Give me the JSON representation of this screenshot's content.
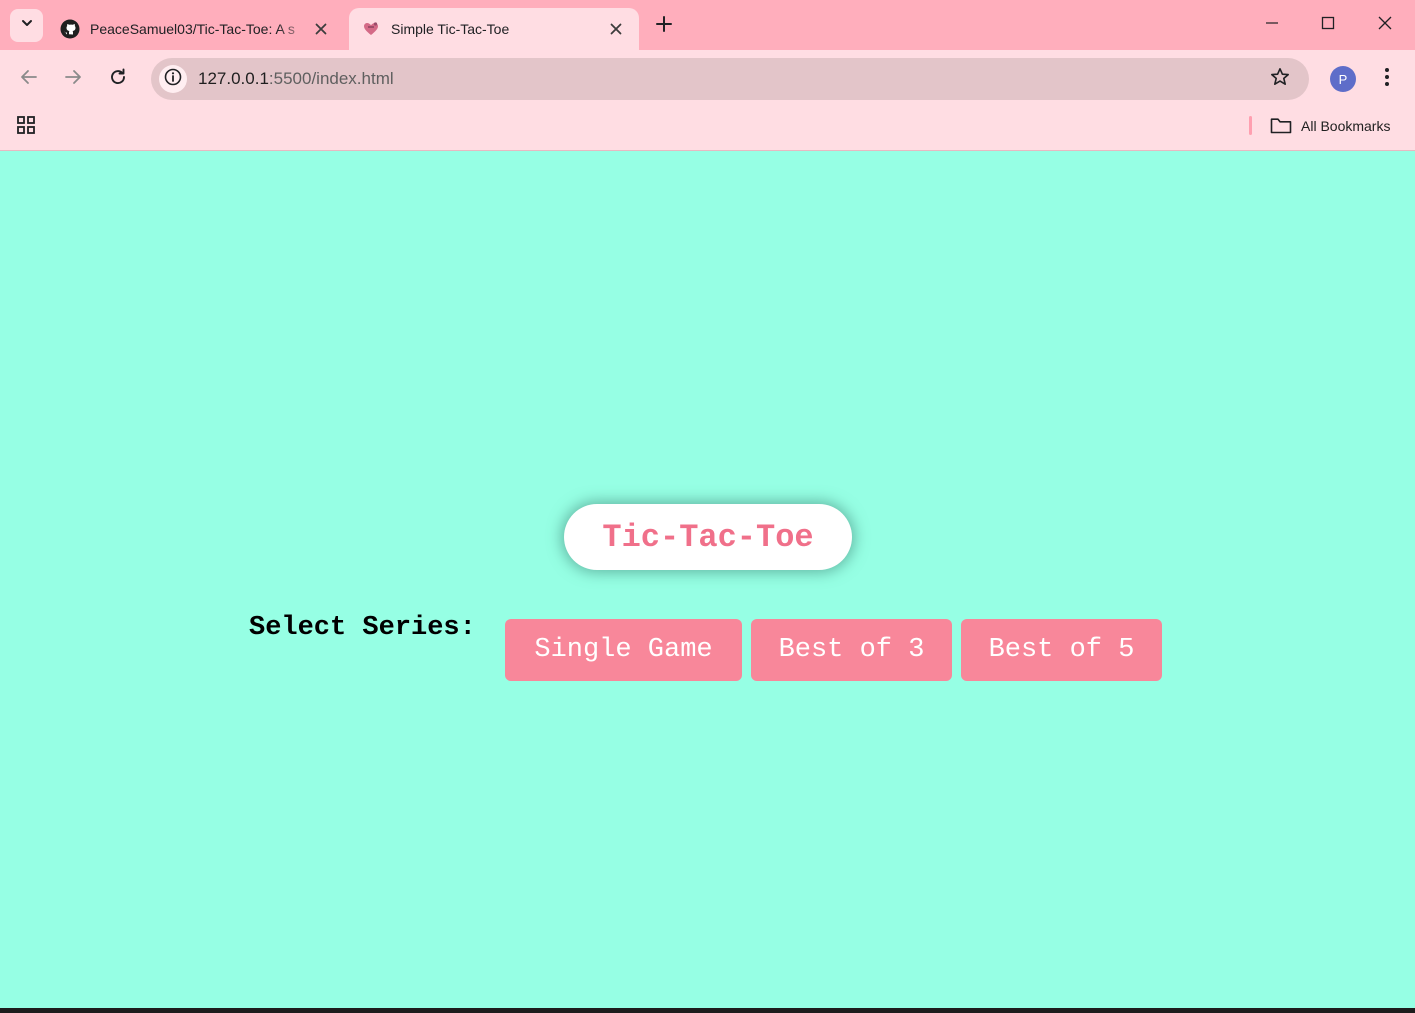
{
  "browser": {
    "tabs": [
      {
        "title": "PeaceSamuel03/Tic-Tac-Toe: A s",
        "favicon": "github-icon",
        "active": false
      },
      {
        "title": "Simple Tic-Tac-Toe",
        "favicon": "heart-favicon-icon",
        "active": true
      }
    ],
    "address": {
      "host": "127.0.0.1",
      "rest": ":5500/index.html"
    },
    "profile_initial": "P",
    "bookmarks": {
      "all_bookmarks_label": "All Bookmarks"
    }
  },
  "page": {
    "title": "Tic-Tac-Toe",
    "series_label": "Select Series:",
    "series_buttons": [
      {
        "label": "Single Game"
      },
      {
        "label": "Best of 3"
      },
      {
        "label": "Best of 5"
      }
    ]
  },
  "colors": {
    "page_background": "#96ffe4",
    "tab_strip": "#ffaebc",
    "toolbar": "#ffdde3",
    "title_text": "#f0708a",
    "button_background": "#f8879a",
    "button_text": "#ffffff"
  }
}
